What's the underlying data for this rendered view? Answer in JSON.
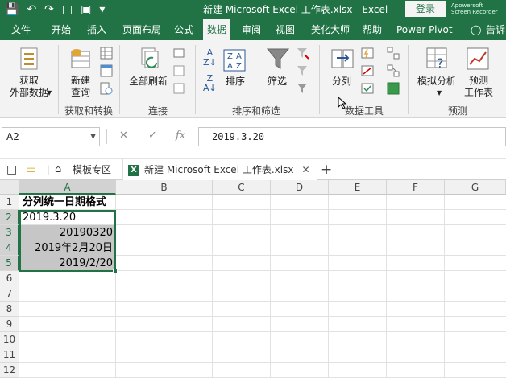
{
  "window": {
    "title": "新建 Microsoft Excel 工作表.xlsx  -  Excel",
    "login_label": "登录",
    "watermark_line1": "Apowersoft",
    "watermark_line2": "Screen Recorder"
  },
  "ribbon_tabs": [
    "文件",
    "开始",
    "插入",
    "页面布局",
    "公式",
    "数据",
    "审阅",
    "视图",
    "美化大师",
    "帮助",
    "Power Pivot",
    "告诉"
  ],
  "active_tab": "数据",
  "ribbon": {
    "get_data_line1": "获取",
    "get_data_line2": "外部数据",
    "new_query_line1": "新建",
    "new_query_line2": "查询",
    "refresh_all": "全部刷新",
    "sort": "排序",
    "filter": "筛选",
    "text_to_columns": "分列",
    "what_if": "模拟分析",
    "forecast_line1": "预测",
    "forecast_line2": "工作表",
    "groups": {
      "get_transform": "获取和转换",
      "connections": "连接",
      "sort_filter": "排序和筛选",
      "data_tools": "数据工具",
      "forecast": "预测"
    }
  },
  "formula_bar": {
    "name_box": "A2",
    "fx_label": "fx",
    "value": "2019.3.20"
  },
  "doc_tabs": {
    "template_zone": "模板专区",
    "workbook": "新建 Microsoft Excel 工作表.xlsx",
    "add": "+"
  },
  "grid": {
    "columns": [
      "A",
      "B",
      "C",
      "D",
      "E",
      "F",
      "G"
    ],
    "rows": [
      "1",
      "2",
      "3",
      "4",
      "5",
      "6",
      "7",
      "8",
      "9",
      "10",
      "11",
      "12"
    ],
    "cells": {
      "a1": "分列统一日期格式",
      "a2": "2019.3.20",
      "a3": "20190320",
      "a4": "2019年2月20日",
      "a5": "2019/2/20"
    }
  },
  "colors": {
    "brand": "#217346",
    "selection_shade": "#c6c6c6"
  }
}
